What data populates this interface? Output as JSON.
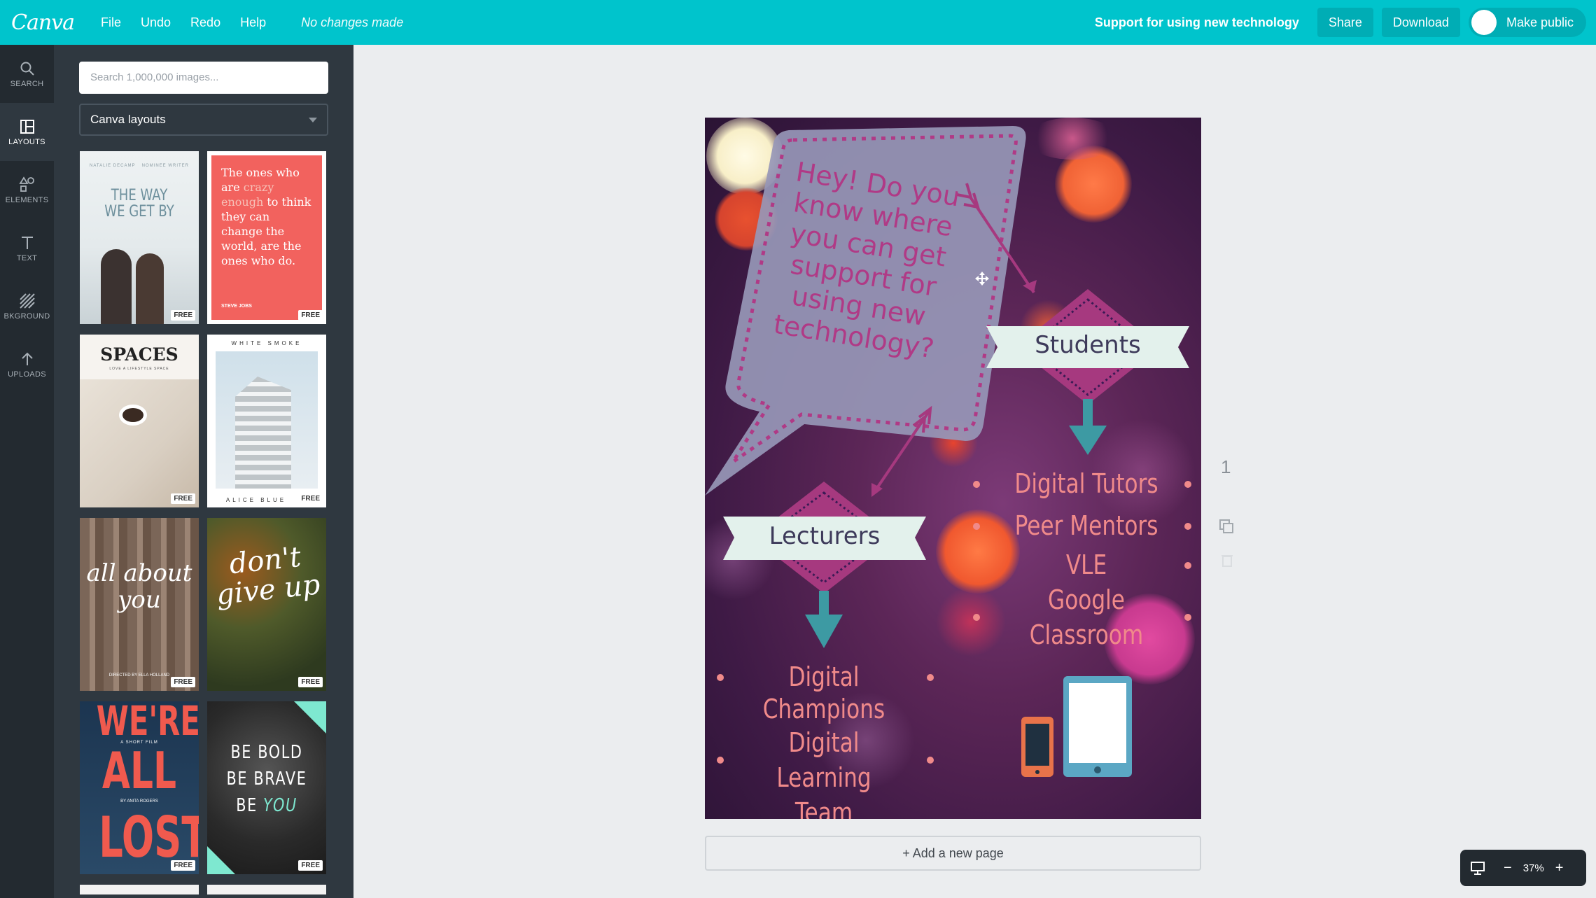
{
  "topbar": {
    "logo": "Canva",
    "menu": [
      "File",
      "Undo",
      "Redo",
      "Help"
    ],
    "status": "No changes made",
    "support": "Support for using new technology",
    "share": "Share",
    "download": "Download",
    "make_public": "Make public"
  },
  "rail": [
    {
      "label": "SEARCH",
      "icon": "search-icon"
    },
    {
      "label": "LAYOUTS",
      "icon": "layout-icon"
    },
    {
      "label": "ELEMENTS",
      "icon": "shapes-icon"
    },
    {
      "label": "TEXT",
      "icon": "text-icon"
    },
    {
      "label": "BKGROUND",
      "icon": "hatch-icon"
    },
    {
      "label": "UPLOADS",
      "icon": "upload-arrow-icon"
    }
  ],
  "panel": {
    "search_placeholder": "Search 1,000,000 images...",
    "select_value": "Canva layouts",
    "free": "FREE",
    "thumbs": {
      "t1_top": "NATALIE DECAMP",
      "t1_top2": "NOMINEE WRITER",
      "t1_title": "THE WAY WE GET BY",
      "t2_quote_a": "The ones who are ",
      "t2_quote_b": "crazy enough",
      "t2_quote_c": " to think they can change the world, are the ones who do.",
      "t2_author": "STEVE JOBS",
      "t3_title": "SPACES",
      "t3_sub": "LOVE A LIFESTYLE SPACE",
      "t4_title": "WHITE SMOKE",
      "t4_bottom": "ALICE BLUE",
      "t5_title": "all about you",
      "t5_bottom": "DIRECTED BY ELLA HOLLAND",
      "t6_title": "don't give up",
      "t7_title1": "WE'RE",
      "t7_small": "A SHORT FILM",
      "t7_title2": "ALL",
      "t7_by": "BY ANITA ROGERS",
      "t7_title3": "LOST",
      "t8_line1": "BE BOLD",
      "t8_line2": "BE BRAVE",
      "t8_line3a": "BE ",
      "t8_line3b": "YOU"
    }
  },
  "design": {
    "bubble": "Hey! Do you know where you can get support for using new technology?",
    "students": "Students",
    "lecturers": "Lecturers",
    "student_items": [
      "Digital Tutors",
      "Peer Mentors",
      "VLE",
      "Google Classroom"
    ],
    "lecturer_items": [
      "Digital Champions",
      "Digital Learning Team"
    ]
  },
  "add_page": "+ Add a new page",
  "page_number": "1",
  "zoom": "37%",
  "colors": {
    "accent": "#00c4cc",
    "coral": "#f08a8a",
    "magenta": "#a6397f",
    "teal": "#3d9aa3",
    "banner": "#e3f1ec"
  }
}
